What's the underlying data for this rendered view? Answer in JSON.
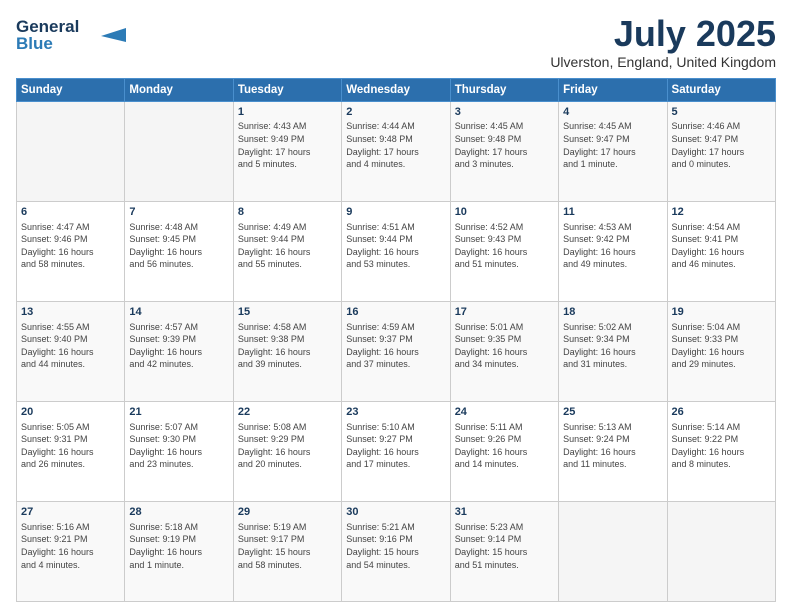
{
  "header": {
    "logo_line1": "General",
    "logo_line2": "Blue",
    "month": "July 2025",
    "location": "Ulverston, England, United Kingdom"
  },
  "weekdays": [
    "Sunday",
    "Monday",
    "Tuesday",
    "Wednesday",
    "Thursday",
    "Friday",
    "Saturday"
  ],
  "weeks": [
    [
      {
        "day": "",
        "info": ""
      },
      {
        "day": "",
        "info": ""
      },
      {
        "day": "1",
        "info": "Sunrise: 4:43 AM\nSunset: 9:49 PM\nDaylight: 17 hours\nand 5 minutes."
      },
      {
        "day": "2",
        "info": "Sunrise: 4:44 AM\nSunset: 9:48 PM\nDaylight: 17 hours\nand 4 minutes."
      },
      {
        "day": "3",
        "info": "Sunrise: 4:45 AM\nSunset: 9:48 PM\nDaylight: 17 hours\nand 3 minutes."
      },
      {
        "day": "4",
        "info": "Sunrise: 4:45 AM\nSunset: 9:47 PM\nDaylight: 17 hours\nand 1 minute."
      },
      {
        "day": "5",
        "info": "Sunrise: 4:46 AM\nSunset: 9:47 PM\nDaylight: 17 hours\nand 0 minutes."
      }
    ],
    [
      {
        "day": "6",
        "info": "Sunrise: 4:47 AM\nSunset: 9:46 PM\nDaylight: 16 hours\nand 58 minutes."
      },
      {
        "day": "7",
        "info": "Sunrise: 4:48 AM\nSunset: 9:45 PM\nDaylight: 16 hours\nand 56 minutes."
      },
      {
        "day": "8",
        "info": "Sunrise: 4:49 AM\nSunset: 9:44 PM\nDaylight: 16 hours\nand 55 minutes."
      },
      {
        "day": "9",
        "info": "Sunrise: 4:51 AM\nSunset: 9:44 PM\nDaylight: 16 hours\nand 53 minutes."
      },
      {
        "day": "10",
        "info": "Sunrise: 4:52 AM\nSunset: 9:43 PM\nDaylight: 16 hours\nand 51 minutes."
      },
      {
        "day": "11",
        "info": "Sunrise: 4:53 AM\nSunset: 9:42 PM\nDaylight: 16 hours\nand 49 minutes."
      },
      {
        "day": "12",
        "info": "Sunrise: 4:54 AM\nSunset: 9:41 PM\nDaylight: 16 hours\nand 46 minutes."
      }
    ],
    [
      {
        "day": "13",
        "info": "Sunrise: 4:55 AM\nSunset: 9:40 PM\nDaylight: 16 hours\nand 44 minutes."
      },
      {
        "day": "14",
        "info": "Sunrise: 4:57 AM\nSunset: 9:39 PM\nDaylight: 16 hours\nand 42 minutes."
      },
      {
        "day": "15",
        "info": "Sunrise: 4:58 AM\nSunset: 9:38 PM\nDaylight: 16 hours\nand 39 minutes."
      },
      {
        "day": "16",
        "info": "Sunrise: 4:59 AM\nSunset: 9:37 PM\nDaylight: 16 hours\nand 37 minutes."
      },
      {
        "day": "17",
        "info": "Sunrise: 5:01 AM\nSunset: 9:35 PM\nDaylight: 16 hours\nand 34 minutes."
      },
      {
        "day": "18",
        "info": "Sunrise: 5:02 AM\nSunset: 9:34 PM\nDaylight: 16 hours\nand 31 minutes."
      },
      {
        "day": "19",
        "info": "Sunrise: 5:04 AM\nSunset: 9:33 PM\nDaylight: 16 hours\nand 29 minutes."
      }
    ],
    [
      {
        "day": "20",
        "info": "Sunrise: 5:05 AM\nSunset: 9:31 PM\nDaylight: 16 hours\nand 26 minutes."
      },
      {
        "day": "21",
        "info": "Sunrise: 5:07 AM\nSunset: 9:30 PM\nDaylight: 16 hours\nand 23 minutes."
      },
      {
        "day": "22",
        "info": "Sunrise: 5:08 AM\nSunset: 9:29 PM\nDaylight: 16 hours\nand 20 minutes."
      },
      {
        "day": "23",
        "info": "Sunrise: 5:10 AM\nSunset: 9:27 PM\nDaylight: 16 hours\nand 17 minutes."
      },
      {
        "day": "24",
        "info": "Sunrise: 5:11 AM\nSunset: 9:26 PM\nDaylight: 16 hours\nand 14 minutes."
      },
      {
        "day": "25",
        "info": "Sunrise: 5:13 AM\nSunset: 9:24 PM\nDaylight: 16 hours\nand 11 minutes."
      },
      {
        "day": "26",
        "info": "Sunrise: 5:14 AM\nSunset: 9:22 PM\nDaylight: 16 hours\nand 8 minutes."
      }
    ],
    [
      {
        "day": "27",
        "info": "Sunrise: 5:16 AM\nSunset: 9:21 PM\nDaylight: 16 hours\nand 4 minutes."
      },
      {
        "day": "28",
        "info": "Sunrise: 5:18 AM\nSunset: 9:19 PM\nDaylight: 16 hours\nand 1 minute."
      },
      {
        "day": "29",
        "info": "Sunrise: 5:19 AM\nSunset: 9:17 PM\nDaylight: 15 hours\nand 58 minutes."
      },
      {
        "day": "30",
        "info": "Sunrise: 5:21 AM\nSunset: 9:16 PM\nDaylight: 15 hours\nand 54 minutes."
      },
      {
        "day": "31",
        "info": "Sunrise: 5:23 AM\nSunset: 9:14 PM\nDaylight: 15 hours\nand 51 minutes."
      },
      {
        "day": "",
        "info": ""
      },
      {
        "day": "",
        "info": ""
      }
    ]
  ]
}
